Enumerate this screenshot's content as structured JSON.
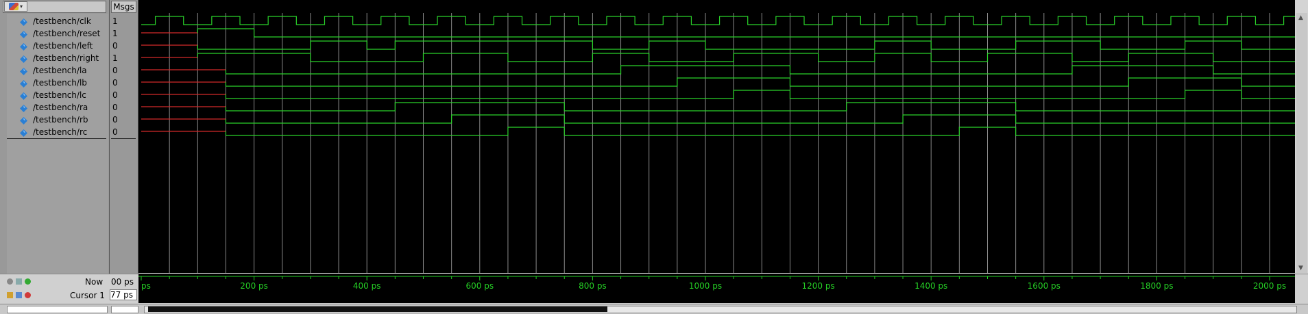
{
  "header": {
    "msgs_label": "Msgs"
  },
  "signals": [
    {
      "name": "/testbench/clk",
      "value": "1"
    },
    {
      "name": "/testbench/reset",
      "value": "1"
    },
    {
      "name": "/testbench/left",
      "value": "0"
    },
    {
      "name": "/testbench/right",
      "value": "1"
    },
    {
      "name": "/testbench/la",
      "value": "0"
    },
    {
      "name": "/testbench/lb",
      "value": "0"
    },
    {
      "name": "/testbench/lc",
      "value": "0"
    },
    {
      "name": "/testbench/ra",
      "value": "0"
    },
    {
      "name": "/testbench/rb",
      "value": "0"
    },
    {
      "name": "/testbench/rc",
      "value": "0"
    }
  ],
  "status": {
    "now_label": "Now",
    "now_value": "00 ps",
    "cursor_label": "Cursor 1",
    "cursor_value": "77 ps"
  },
  "timeline": {
    "labels": [
      "ps",
      "200 ps",
      "400 ps",
      "600 ps",
      "800 ps",
      "1000 ps",
      "1200 ps",
      "1400 ps",
      "1600 ps",
      "1800 ps",
      "2000 ps"
    ]
  },
  "colors": {
    "wave": "#2ad42a",
    "undefined": "#d42a2a",
    "grid": "#8a8a8a",
    "icon": "#2a7fd4"
  }
}
